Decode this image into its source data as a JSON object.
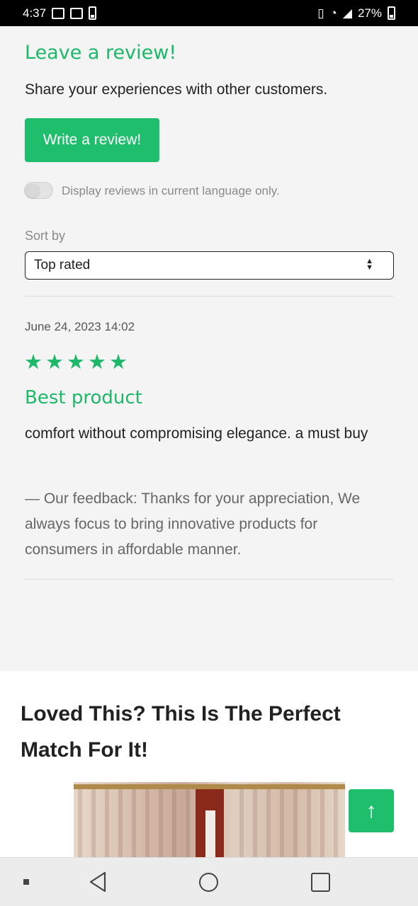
{
  "status_bar": {
    "time": "4:37",
    "battery": "27%",
    "icons": [
      "gallery-icon",
      "news-icon",
      "battery-saver-icon",
      "vibrate-icon",
      "wifi-icon",
      "signal-icon",
      "battery-icon"
    ]
  },
  "review": {
    "heading": "Leave a review!",
    "subtext": "Share your experiences with other customers.",
    "write_button": "Write a review!",
    "toggle_label": "Display reviews in current language only.",
    "toggle_on": false,
    "sort_label": "Sort by",
    "sort_value": "Top rated"
  },
  "reviews": [
    {
      "date": "June 24, 2023 14:02",
      "rating": 5,
      "title": "Best product",
      "body": "comfort without compromising elegance. a must buy",
      "feedback": "— Our feedback: Thanks for your appreciation, We always focus to bring innovative products for consumers in affordable manner."
    }
  ],
  "related": {
    "title": "Loved This? This Is The Perfect Match For It!"
  },
  "colors": {
    "accent": "#1ebe6d",
    "text": "#222222",
    "muted": "#8a8a8a"
  }
}
